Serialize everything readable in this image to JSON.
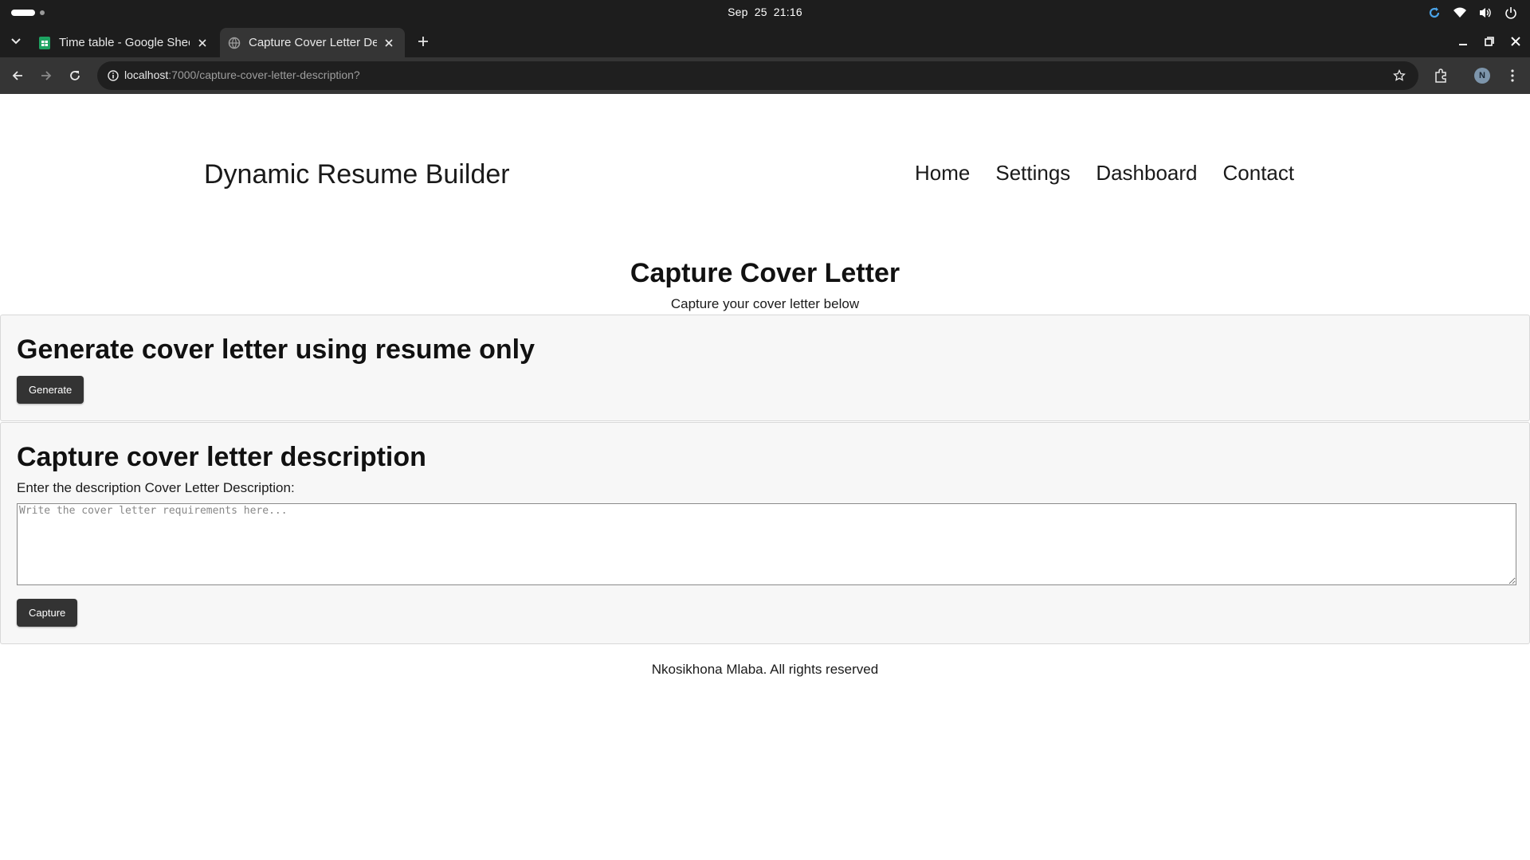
{
  "os": {
    "clock": "Sep 25  21:16"
  },
  "browser": {
    "tabs": [
      {
        "title": "Time table - Google Sheets",
        "icon": "sheets-icon"
      },
      {
        "title": "Capture Cover Letter Description",
        "icon": "globe-icon"
      }
    ],
    "url_host": "localhost",
    "url_path": ":7000/capture-cover-letter-description?",
    "profile_initial": "N"
  },
  "site": {
    "brand": "Dynamic Resume Builder",
    "nav": [
      "Home",
      "Settings",
      "Dashboard",
      "Contact"
    ]
  },
  "main": {
    "title": "Capture Cover Letter",
    "subtitle": "Capture your cover letter below",
    "generate_card": {
      "heading": "Generate cover letter using resume only",
      "button": "Generate"
    },
    "capture_card": {
      "heading": "Capture cover letter description",
      "label": "Enter the description Cover Letter Description:",
      "placeholder": "Write the cover letter requirements here...",
      "value": "",
      "button": "Capture"
    }
  },
  "footer": {
    "text": "Nkosikhona Mlaba. All rights reserved"
  },
  "colors": {
    "os_bar": "#1d1d1d",
    "toolbar": "#353535",
    "button": "#333333",
    "card_bg": "#f7f7f7",
    "sheets_green": "#1ea362"
  }
}
